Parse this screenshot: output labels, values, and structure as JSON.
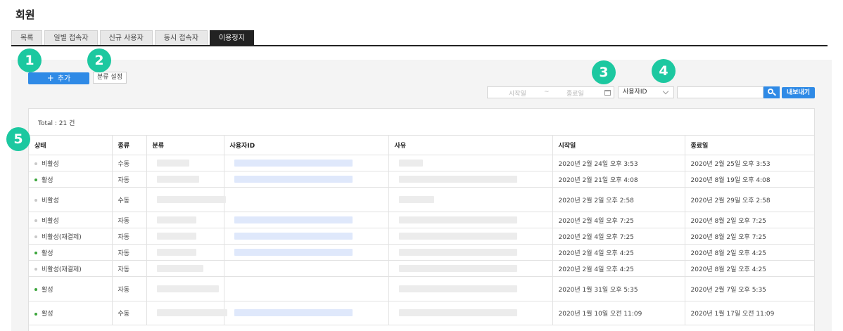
{
  "page": {
    "title": "회원"
  },
  "tabs": [
    "목록",
    "일별 접속자",
    "신규 사용자",
    "동시 접속자",
    "이용정지"
  ],
  "active_tab": "이용정지",
  "toolbar": {
    "add_plus": "+",
    "add_label": "추가",
    "category_label": "분류 설정"
  },
  "badges": [
    "1",
    "2",
    "3",
    "4",
    "5"
  ],
  "filter": {
    "start_placeholder": "시작일",
    "range_sep": "~",
    "end_placeholder": "종료일",
    "select_value": "사용자ID",
    "export_label": "내보내기"
  },
  "table": {
    "total": "Total : 21 건",
    "headers": [
      "상태",
      "종류",
      "분류",
      "사용자ID",
      "사유",
      "시작일",
      "종료일"
    ],
    "rows": [
      {
        "status": "비활성",
        "active": false,
        "type": "수동",
        "start": "2020년 2월 24일 오후 3:53",
        "end": "2020년 2월 25일 오후 3:53"
      },
      {
        "status": "활성",
        "active": true,
        "type": "자동",
        "start": "2020년 2월 21일 오후 4:08",
        "end": "2020년 8월 19일 오후 4:08"
      },
      {
        "status": "비활성",
        "active": false,
        "type": "수동",
        "start": "2020년 2월 2일 오후 2:58",
        "end": "2020년 2월 29일 오후 2:58"
      },
      {
        "status": "비활성",
        "active": false,
        "type": "자동",
        "start": "2020년 2월 4일 오후 7:25",
        "end": "2020년 8월 2일 오후 7:25"
      },
      {
        "status": "비활성(재결제)",
        "active": false,
        "type": "자동",
        "start": "2020년 2월 4일 오후 7:25",
        "end": "2020년 8월 2일 오후 7:25"
      },
      {
        "status": "활성",
        "active": true,
        "type": "자동",
        "start": "2020년 2월 4일 오후 4:25",
        "end": "2020년 8월 2일 오후 4:25"
      },
      {
        "status": "비활성(재결제)",
        "active": false,
        "type": "자동",
        "start": "2020년 2월 4일 오후 4:25",
        "end": "2020년 8월 2일 오후 4:25"
      },
      {
        "status": "활성",
        "active": true,
        "type": "자동",
        "start": "2020년 1월 31일 오후 5:35",
        "end": "2020년 2월 7일 오후 5:35"
      },
      {
        "status": "활성",
        "active": true,
        "type": "수동",
        "start": "2020년 1월 10일 오전 11:09",
        "end": "2020년 1월 17일 오전 11:09"
      }
    ]
  },
  "colors": {
    "accent": "#2f8ae6",
    "badge": "#1cc8a0",
    "active_dot": "#3aa53a",
    "inactive_dot": "#c8c8c8"
  }
}
